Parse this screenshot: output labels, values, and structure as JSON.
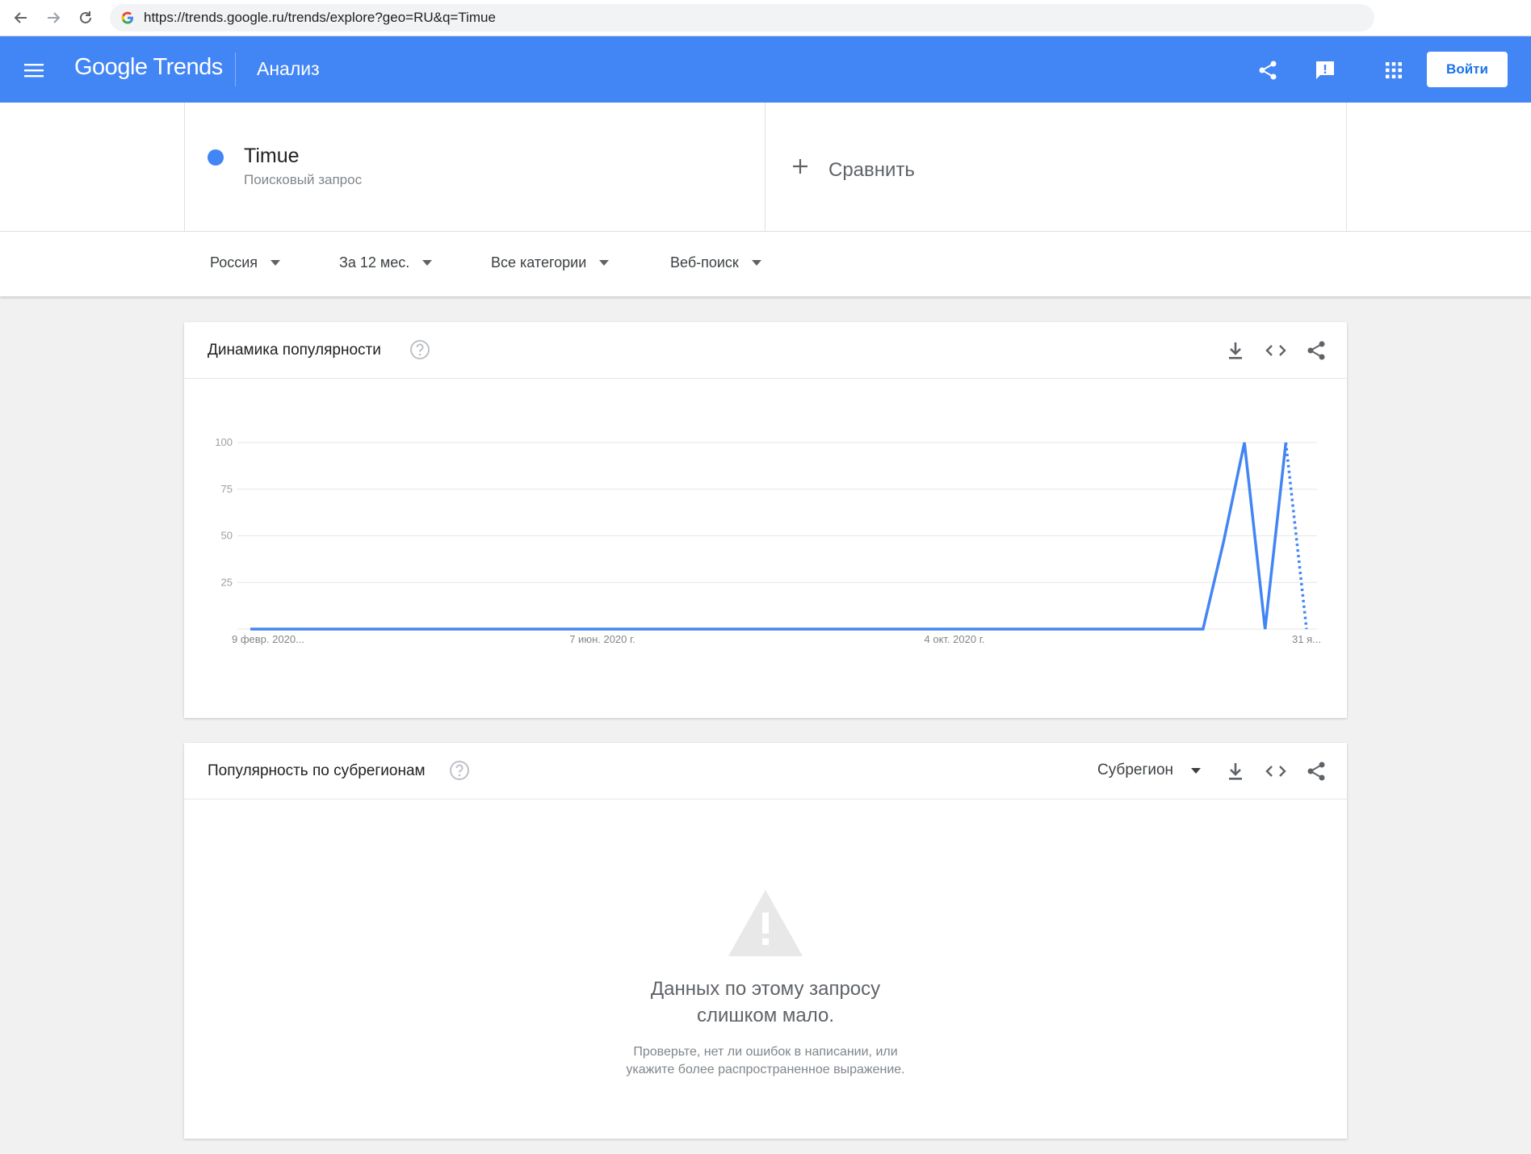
{
  "browser": {
    "url": "https://trends.google.ru/trends/explore?geo=RU&q=Timue"
  },
  "header": {
    "logo": "Google Trends",
    "title": "Анализ",
    "signin_label": "Войти"
  },
  "term": {
    "name": "Timue",
    "type": "Поисковый запрос",
    "color": "#4285f4"
  },
  "compare": {
    "label": "Сравнить"
  },
  "filters": {
    "region": "Россия",
    "period": "За 12 мес.",
    "category": "Все категории",
    "search_type": "Веб-поиск"
  },
  "interest_card": {
    "title": "Динамика популярности"
  },
  "subregion_card": {
    "title": "Популярность по субрегионам",
    "select_label": "Субрегион",
    "no_data_title_1": "Данных по этому запросу",
    "no_data_title_2": "слишком мало.",
    "no_data_hint_1": "Проверьте, нет ли ошибок в написании, или",
    "no_data_hint_2": "укажите более распространенное выражение."
  },
  "chart_data": {
    "type": "line",
    "ylim": [
      0,
      100
    ],
    "yticks": [
      100,
      75,
      50,
      25
    ],
    "xtick_labels": [
      "9 февр. 2020...",
      "7 июн. 2020 г.",
      "4 окт. 2020 г.",
      "31 я..."
    ],
    "xtick_weeks": [
      0,
      17,
      34,
      51
    ],
    "grid": true,
    "series": [
      {
        "color": "#4285f4",
        "values": [
          0,
          0,
          0,
          0,
          0,
          0,
          0,
          0,
          0,
          0,
          0,
          0,
          0,
          0,
          0,
          0,
          0,
          0,
          0,
          0,
          0,
          0,
          0,
          0,
          0,
          0,
          0,
          0,
          0,
          0,
          0,
          0,
          0,
          0,
          0,
          0,
          0,
          0,
          0,
          0,
          0,
          0,
          0,
          0,
          0,
          0,
          0,
          47,
          100,
          0,
          100,
          0
        ],
        "partial_from_index": 50
      }
    ]
  }
}
